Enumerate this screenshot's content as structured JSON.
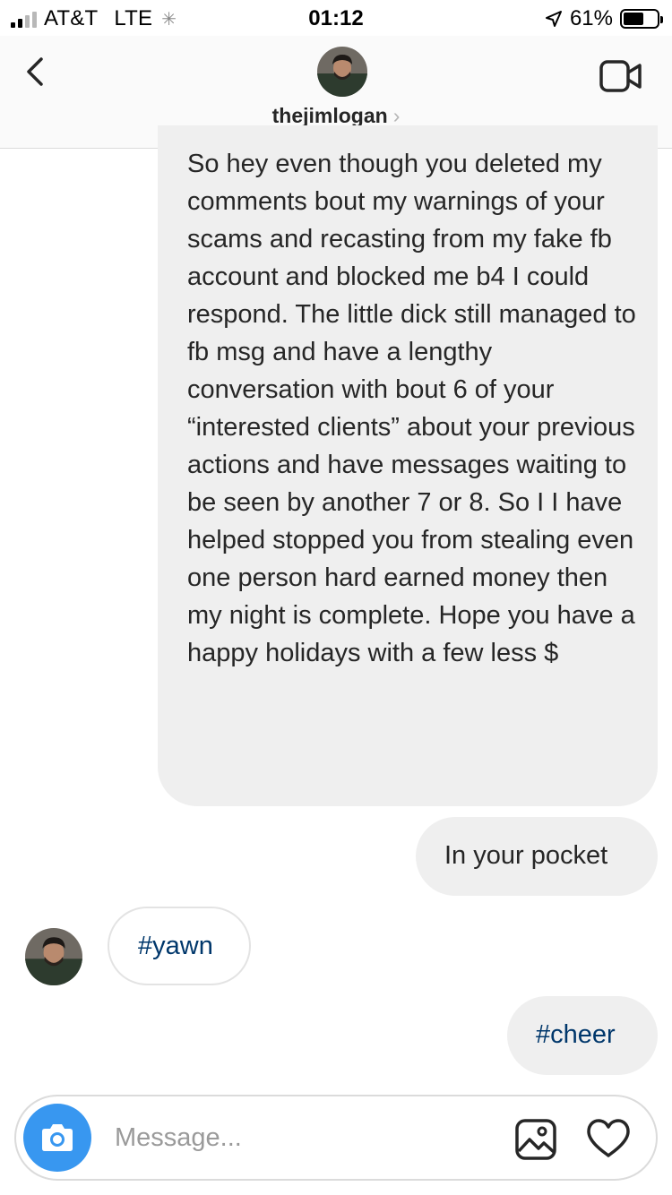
{
  "status_bar": {
    "carrier": "AT&T",
    "network": "LTE",
    "time": "01:12",
    "battery_percent": "61%",
    "battery_level": 0.61
  },
  "header": {
    "username": "thejimlogan",
    "icons": [
      "back-chevron-icon",
      "profile-avatar",
      "video-camera-icon"
    ]
  },
  "messages": [
    {
      "sender": "me",
      "text": "So hey even though you deleted my comments bout my warnings of your scams and recasting from my fake fb account and blocked me b4 I could respond. The little dick still managed to fb msg and have a lengthy conversation with bout 6 of your “interested clients” about your previous actions and have messages waiting to be seen by another 7 or 8. So I I have helped stopped you from stealing even one person hard earned money then my night is complete. Hope you have a happy holidays with a few less $"
    },
    {
      "sender": "me",
      "text": "In your pocket"
    },
    {
      "sender": "them",
      "text": "#yawn"
    },
    {
      "sender": "me",
      "text": "#cheer"
    }
  ],
  "composer": {
    "placeholder": "Message...",
    "value": "",
    "icons": [
      "camera-icon",
      "gallery-icon",
      "heart-icon"
    ]
  },
  "colors": {
    "accent_blue": "#3897f0",
    "hashtag_blue": "#00376b",
    "bubble_gray": "#efefef"
  }
}
